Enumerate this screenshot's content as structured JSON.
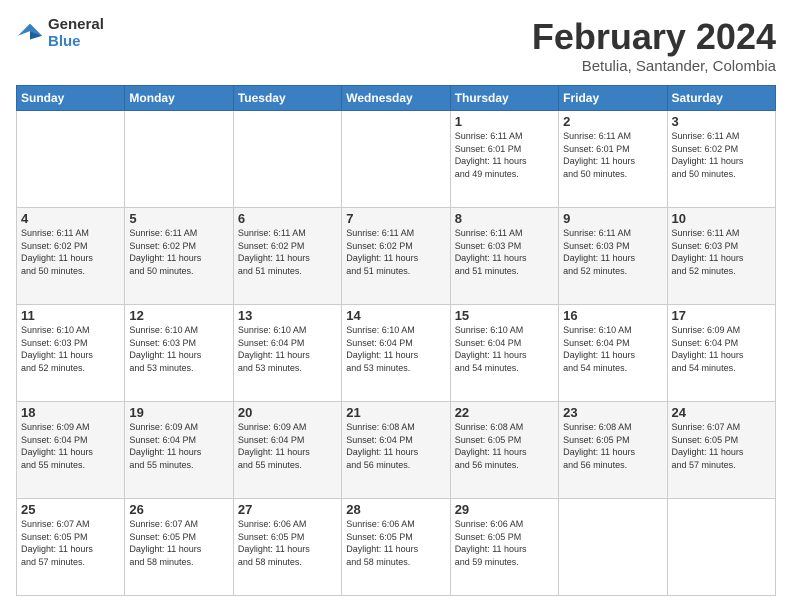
{
  "logo": {
    "line1": "General",
    "line2": "Blue"
  },
  "title": "February 2024",
  "subtitle": "Betulia, Santander, Colombia",
  "days_of_week": [
    "Sunday",
    "Monday",
    "Tuesday",
    "Wednesday",
    "Thursday",
    "Friday",
    "Saturday"
  ],
  "weeks": [
    [
      {
        "day": "",
        "info": ""
      },
      {
        "day": "",
        "info": ""
      },
      {
        "day": "",
        "info": ""
      },
      {
        "day": "",
        "info": ""
      },
      {
        "day": "1",
        "info": "Sunrise: 6:11 AM\nSunset: 6:01 PM\nDaylight: 11 hours\nand 49 minutes."
      },
      {
        "day": "2",
        "info": "Sunrise: 6:11 AM\nSunset: 6:01 PM\nDaylight: 11 hours\nand 50 minutes."
      },
      {
        "day": "3",
        "info": "Sunrise: 6:11 AM\nSunset: 6:02 PM\nDaylight: 11 hours\nand 50 minutes."
      }
    ],
    [
      {
        "day": "4",
        "info": "Sunrise: 6:11 AM\nSunset: 6:02 PM\nDaylight: 11 hours\nand 50 minutes."
      },
      {
        "day": "5",
        "info": "Sunrise: 6:11 AM\nSunset: 6:02 PM\nDaylight: 11 hours\nand 50 minutes."
      },
      {
        "day": "6",
        "info": "Sunrise: 6:11 AM\nSunset: 6:02 PM\nDaylight: 11 hours\nand 51 minutes."
      },
      {
        "day": "7",
        "info": "Sunrise: 6:11 AM\nSunset: 6:02 PM\nDaylight: 11 hours\nand 51 minutes."
      },
      {
        "day": "8",
        "info": "Sunrise: 6:11 AM\nSunset: 6:03 PM\nDaylight: 11 hours\nand 51 minutes."
      },
      {
        "day": "9",
        "info": "Sunrise: 6:11 AM\nSunset: 6:03 PM\nDaylight: 11 hours\nand 52 minutes."
      },
      {
        "day": "10",
        "info": "Sunrise: 6:11 AM\nSunset: 6:03 PM\nDaylight: 11 hours\nand 52 minutes."
      }
    ],
    [
      {
        "day": "11",
        "info": "Sunrise: 6:10 AM\nSunset: 6:03 PM\nDaylight: 11 hours\nand 52 minutes."
      },
      {
        "day": "12",
        "info": "Sunrise: 6:10 AM\nSunset: 6:03 PM\nDaylight: 11 hours\nand 53 minutes."
      },
      {
        "day": "13",
        "info": "Sunrise: 6:10 AM\nSunset: 6:04 PM\nDaylight: 11 hours\nand 53 minutes."
      },
      {
        "day": "14",
        "info": "Sunrise: 6:10 AM\nSunset: 6:04 PM\nDaylight: 11 hours\nand 53 minutes."
      },
      {
        "day": "15",
        "info": "Sunrise: 6:10 AM\nSunset: 6:04 PM\nDaylight: 11 hours\nand 54 minutes."
      },
      {
        "day": "16",
        "info": "Sunrise: 6:10 AM\nSunset: 6:04 PM\nDaylight: 11 hours\nand 54 minutes."
      },
      {
        "day": "17",
        "info": "Sunrise: 6:09 AM\nSunset: 6:04 PM\nDaylight: 11 hours\nand 54 minutes."
      }
    ],
    [
      {
        "day": "18",
        "info": "Sunrise: 6:09 AM\nSunset: 6:04 PM\nDaylight: 11 hours\nand 55 minutes."
      },
      {
        "day": "19",
        "info": "Sunrise: 6:09 AM\nSunset: 6:04 PM\nDaylight: 11 hours\nand 55 minutes."
      },
      {
        "day": "20",
        "info": "Sunrise: 6:09 AM\nSunset: 6:04 PM\nDaylight: 11 hours\nand 55 minutes."
      },
      {
        "day": "21",
        "info": "Sunrise: 6:08 AM\nSunset: 6:04 PM\nDaylight: 11 hours\nand 56 minutes."
      },
      {
        "day": "22",
        "info": "Sunrise: 6:08 AM\nSunset: 6:05 PM\nDaylight: 11 hours\nand 56 minutes."
      },
      {
        "day": "23",
        "info": "Sunrise: 6:08 AM\nSunset: 6:05 PM\nDaylight: 11 hours\nand 56 minutes."
      },
      {
        "day": "24",
        "info": "Sunrise: 6:07 AM\nSunset: 6:05 PM\nDaylight: 11 hours\nand 57 minutes."
      }
    ],
    [
      {
        "day": "25",
        "info": "Sunrise: 6:07 AM\nSunset: 6:05 PM\nDaylight: 11 hours\nand 57 minutes."
      },
      {
        "day": "26",
        "info": "Sunrise: 6:07 AM\nSunset: 6:05 PM\nDaylight: 11 hours\nand 58 minutes."
      },
      {
        "day": "27",
        "info": "Sunrise: 6:06 AM\nSunset: 6:05 PM\nDaylight: 11 hours\nand 58 minutes."
      },
      {
        "day": "28",
        "info": "Sunrise: 6:06 AM\nSunset: 6:05 PM\nDaylight: 11 hours\nand 58 minutes."
      },
      {
        "day": "29",
        "info": "Sunrise: 6:06 AM\nSunset: 6:05 PM\nDaylight: 11 hours\nand 59 minutes."
      },
      {
        "day": "",
        "info": ""
      },
      {
        "day": "",
        "info": ""
      }
    ]
  ]
}
